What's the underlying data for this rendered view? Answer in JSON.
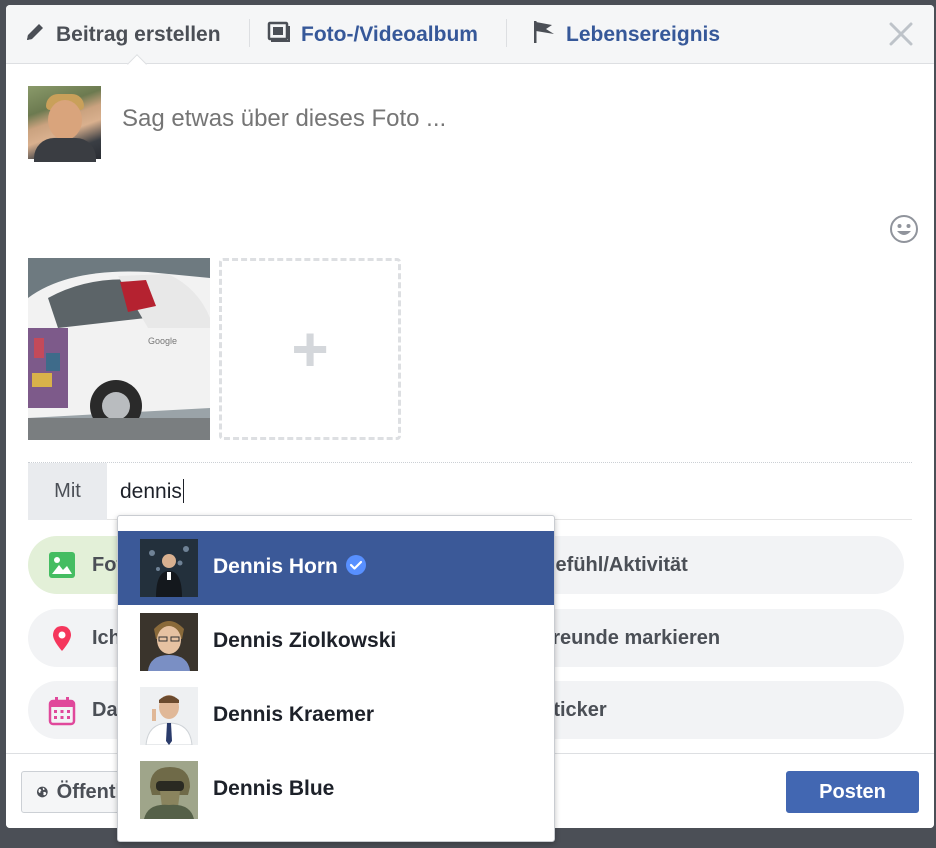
{
  "header": {
    "tabs": [
      {
        "label": "Beitrag erstellen",
        "icon": "pencil-icon"
      },
      {
        "label": "Foto-/Videoalbum",
        "icon": "photo-album-icon"
      },
      {
        "label": "Lebensereignis",
        "icon": "flag-icon"
      }
    ],
    "close_icon": "close-icon"
  },
  "composer": {
    "placeholder": "Sag etwas über dieses Foto ..."
  },
  "with": {
    "label": "Mit",
    "value": "dennis"
  },
  "options": {
    "photo_video": "Foto/Video",
    "feeling": "Gefühl/Aktivität",
    "checkin": "Ich bin hier",
    "tag_friends": "Freunde markieren",
    "date": "Datum",
    "sticker": "Sticker"
  },
  "footer": {
    "audience": "Öffentlich",
    "post_label": "Posten"
  },
  "suggestions": [
    {
      "name": "Dennis Horn",
      "verified": true,
      "selected": true
    },
    {
      "name": "Dennis Ziolkowski",
      "verified": false,
      "selected": false
    },
    {
      "name": "Dennis Kraemer",
      "verified": false,
      "selected": false
    },
    {
      "name": "Dennis Blue",
      "verified": false,
      "selected": false
    }
  ],
  "colors": {
    "accent": "#4267b2",
    "selected_row": "#3b5998",
    "link": "#365899"
  }
}
